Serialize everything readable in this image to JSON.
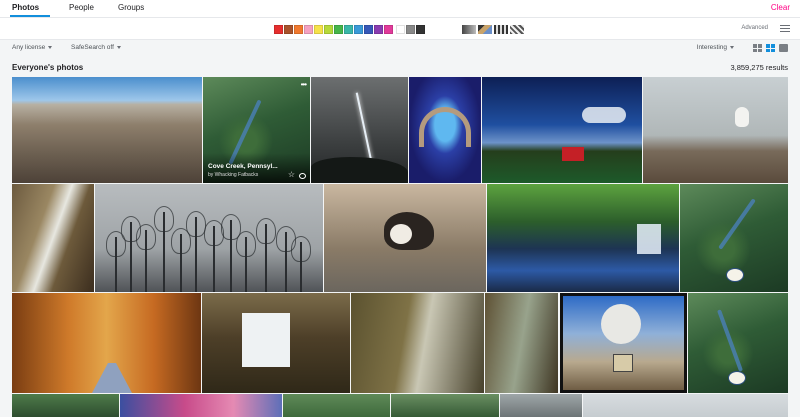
{
  "tabs": [
    {
      "label": "Photos",
      "active": true
    },
    {
      "label": "People",
      "active": false
    },
    {
      "label": "Groups",
      "active": false
    }
  ],
  "clear_label": "Clear",
  "color_swatches": [
    "#e62e2e",
    "#a8522b",
    "#f1792e",
    "#f4a2c2",
    "#f6e24a",
    "#b6d93a",
    "#46b54a",
    "#3ab7a8",
    "#3a9ad8",
    "#3658b8",
    "#8a3cb0",
    "#e23a9a",
    "#ffffff",
    "#888888",
    "#333333"
  ],
  "style_swatches": [
    "black-and-white-style",
    "shallow-depth-style",
    "minimalist-style",
    "patterns-style"
  ],
  "advanced_label": "Advanced",
  "filters": {
    "license": "Any license",
    "safesearch": "SafeSearch off",
    "sort": "Interesting"
  },
  "results": {
    "heading": "Everyone's photos",
    "count": "3,859,275 results"
  },
  "hover_photo": {
    "title": "Cove Creek, Pennsyl...",
    "author": "by Whacking Fatbacks"
  },
  "accent_color": "#128fdc",
  "clear_color": "#ff0084"
}
